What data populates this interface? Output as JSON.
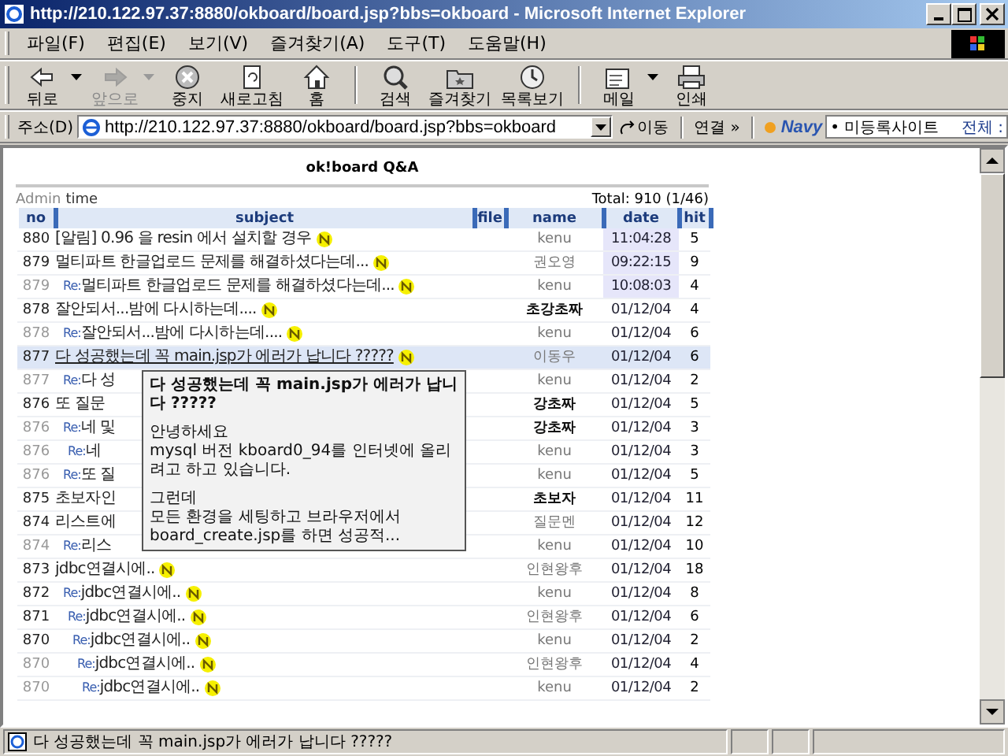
{
  "window": {
    "title": "http://210.122.97.37:8880/okboard/board.jsp?bbs=okboard - Microsoft Internet Explorer"
  },
  "menu": [
    "파일(F)",
    "편집(E)",
    "보기(V)",
    "즐겨찾기(A)",
    "도구(T)",
    "도움말(H)"
  ],
  "toolbar": [
    {
      "label": "뒤로",
      "disabled": false,
      "dropdown": true
    },
    {
      "label": "앞으로",
      "disabled": true,
      "dropdown": true
    },
    {
      "label": "중지",
      "disabled": false,
      "dropdown": false
    },
    {
      "label": "새로고침",
      "disabled": false,
      "dropdown": false
    },
    {
      "label": "홈",
      "disabled": false,
      "dropdown": false
    },
    {
      "label": "검색",
      "disabled": false,
      "dropdown": false
    },
    {
      "label": "즐겨찾기",
      "disabled": false,
      "dropdown": false
    },
    {
      "label": "목록보기",
      "disabled": false,
      "dropdown": false
    },
    {
      "label": "메일",
      "disabled": false,
      "dropdown": true
    },
    {
      "label": "인쇄",
      "disabled": false,
      "dropdown": false
    }
  ],
  "address": {
    "label": "주소(D)",
    "value": "http://210.122.97.37:8880/okboard/board.jsp?bbs=okboard",
    "go": "이동",
    "links": "연결",
    "links_more": "»",
    "navy": "Navy",
    "navy_field": "• 미등록사이트",
    "navy_extra": "전체 :"
  },
  "board": {
    "title": "ok!board Q&A",
    "admin": "Admin",
    "admin_time": "time",
    "total": "Total: 910 (1/46)",
    "columns": [
      "no",
      "subject",
      "file",
      "name",
      "date",
      "hit"
    ],
    "rows": [
      {
        "no": "880",
        "subject": "[알림] 0.96 을 resin 에서 설치할 경우",
        "name": "kenu",
        "date": "11:04:28",
        "hit": "5",
        "new": true,
        "dimmed": false,
        "name_bold": false,
        "today": true,
        "selected": false
      },
      {
        "no": "879",
        "subject": "멀티파트 한글업로드 문제를 해결하셨다는데...",
        "name": "권오영",
        "date": "09:22:15",
        "hit": "9",
        "new": true,
        "dimmed": false,
        "name_bold": false,
        "today": true,
        "selected": false,
        "children": [
          {
            "no": "879",
            "prefix": "Re:",
            "subject": "멀티파트 한글업로드 문제를 해결하셨다는데...",
            "name": "kenu",
            "date": "10:08:03",
            "hit": "4",
            "new": true,
            "dimmed": true,
            "name_bold": false,
            "today": true,
            "selected": false
          }
        ]
      },
      {
        "no": "878",
        "subject": "잘안되서...밤에 다시하는데....",
        "name": "초강초짜",
        "date": "01/12/04",
        "hit": "4",
        "new": true,
        "dimmed": false,
        "name_bold": true,
        "today": false,
        "selected": false,
        "children": [
          {
            "no": "878",
            "prefix": "Re:",
            "subject": "잘안되서...밤에 다시하는데....",
            "name": "kenu",
            "date": "01/12/04",
            "hit": "6",
            "new": true,
            "dimmed": true,
            "name_bold": false,
            "today": false,
            "selected": false
          }
        ]
      },
      {
        "no": "877",
        "subject": "다 성공했는데 꼭 main.jsp가 에러가 납니다 ?????",
        "name": "이동우",
        "date": "01/12/04",
        "hit": "6",
        "new": true,
        "dimmed": false,
        "name_bold": false,
        "today": false,
        "selected": true,
        "children": [
          {
            "no": "877",
            "prefix": "Re:",
            "subject": "다 성",
            "name": "kenu",
            "date": "01/12/04",
            "hit": "2",
            "new": false,
            "dimmed": true,
            "name_bold": false,
            "today": false,
            "selected": false
          }
        ]
      },
      {
        "no": "876",
        "subject": "또 질문",
        "name": "강초짜",
        "date": "01/12/04",
        "hit": "5",
        "new": false,
        "dimmed": false,
        "name_bold": true,
        "today": false,
        "selected": false,
        "children": [
          {
            "no": "876",
            "prefix": "Re:",
            "subject": "네 및",
            "name": "강초짜",
            "date": "01/12/04",
            "hit": "3",
            "new": false,
            "dimmed": true,
            "name_bold": true,
            "today": false,
            "selected": false,
            "children": [
              {
                "no": "876",
                "prefix": "Re:",
                "subject": "네",
                "name": "kenu",
                "date": "01/12/04",
                "hit": "3",
                "new": false,
                "dimmed": true,
                "name_bold": false,
                "today": false,
                "selected": false
              }
            ]
          },
          {
            "no": "876",
            "prefix": "Re:",
            "subject": "또 질",
            "name": "kenu",
            "date": "01/12/04",
            "hit": "5",
            "new": false,
            "dimmed": true,
            "name_bold": false,
            "today": false,
            "selected": false
          }
        ]
      },
      {
        "no": "875",
        "subject": "초보자인",
        "name": "초보자",
        "date": "01/12/04",
        "hit": "11",
        "new": false,
        "dimmed": false,
        "name_bold": true,
        "today": false,
        "selected": false
      },
      {
        "no": "874",
        "subject": "리스트에",
        "name": "질문멘",
        "date": "01/12/04",
        "hit": "12",
        "new": false,
        "dimmed": false,
        "name_bold": false,
        "today": false,
        "selected": false,
        "children": [
          {
            "no": "874",
            "prefix": "Re:",
            "subject": "리스",
            "name": "kenu",
            "date": "01/12/04",
            "hit": "10",
            "new": false,
            "dimmed": true,
            "name_bold": false,
            "today": false,
            "selected": false
          }
        ]
      },
      {
        "no": "873",
        "subject": "jdbc연결시에..",
        "name": "인현왕후",
        "date": "01/12/04",
        "hit": "18",
        "new": true,
        "dimmed": false,
        "name_bold": false,
        "today": false,
        "selected": false,
        "children": [
          {
            "no": "872",
            "prefix": "Re:",
            "subject": "jdbc연결시에..",
            "name": "kenu",
            "date": "01/12/04",
            "hit": "8",
            "new": true,
            "dimmed": false,
            "name_bold": false,
            "today": false,
            "selected": false,
            "children": [
              {
                "no": "871",
                "prefix": "Re:",
                "subject": "jdbc연결시에..",
                "name": "인현왕후",
                "date": "01/12/04",
                "hit": "6",
                "new": true,
                "dimmed": false,
                "name_bold": false,
                "today": false,
                "selected": false,
                "children": [
                  {
                    "no": "870",
                    "prefix": "Re:",
                    "subject": "jdbc연결시에..",
                    "name": "kenu",
                    "date": "01/12/04",
                    "hit": "2",
                    "new": true,
                    "dimmed": false,
                    "name_bold": false,
                    "today": false,
                    "selected": false,
                    "children": [
                      {
                        "no": "870",
                        "prefix": "Re:",
                        "subject": "jdbc연결시에..",
                        "name": "인현왕후",
                        "date": "01/12/04",
                        "hit": "4",
                        "new": true,
                        "dimmed": true,
                        "name_bold": false,
                        "today": false,
                        "selected": false,
                        "children": [
                          {
                            "no": "870",
                            "prefix": "Re:",
                            "subject": "jdbc연결시에..",
                            "name": "kenu",
                            "date": "01/12/04",
                            "hit": "2",
                            "new": true,
                            "dimmed": true,
                            "name_bold": false,
                            "today": false,
                            "selected": false
                          }
                        ]
                      }
                    ]
                  }
                ]
              }
            ]
          }
        ]
      }
    ]
  },
  "tooltip": {
    "title": "다 성공했는데 꼭 main.jsp가 에러가 납니다 ?????",
    "paragraphs": [
      [
        "안녕하세요",
        "mysql 버전 kboard0_94를 인터넷에 올리려고 하고 있습니다."
      ],
      [
        "그런데",
        "모든 환경을 세팅하고 브라우저에서",
        "board_create.jsp를 하면 성공적..."
      ]
    ]
  },
  "status_bar": {
    "text": "다 성공했는데 꼭 main.jsp가 에러가 납니다 ?????"
  }
}
